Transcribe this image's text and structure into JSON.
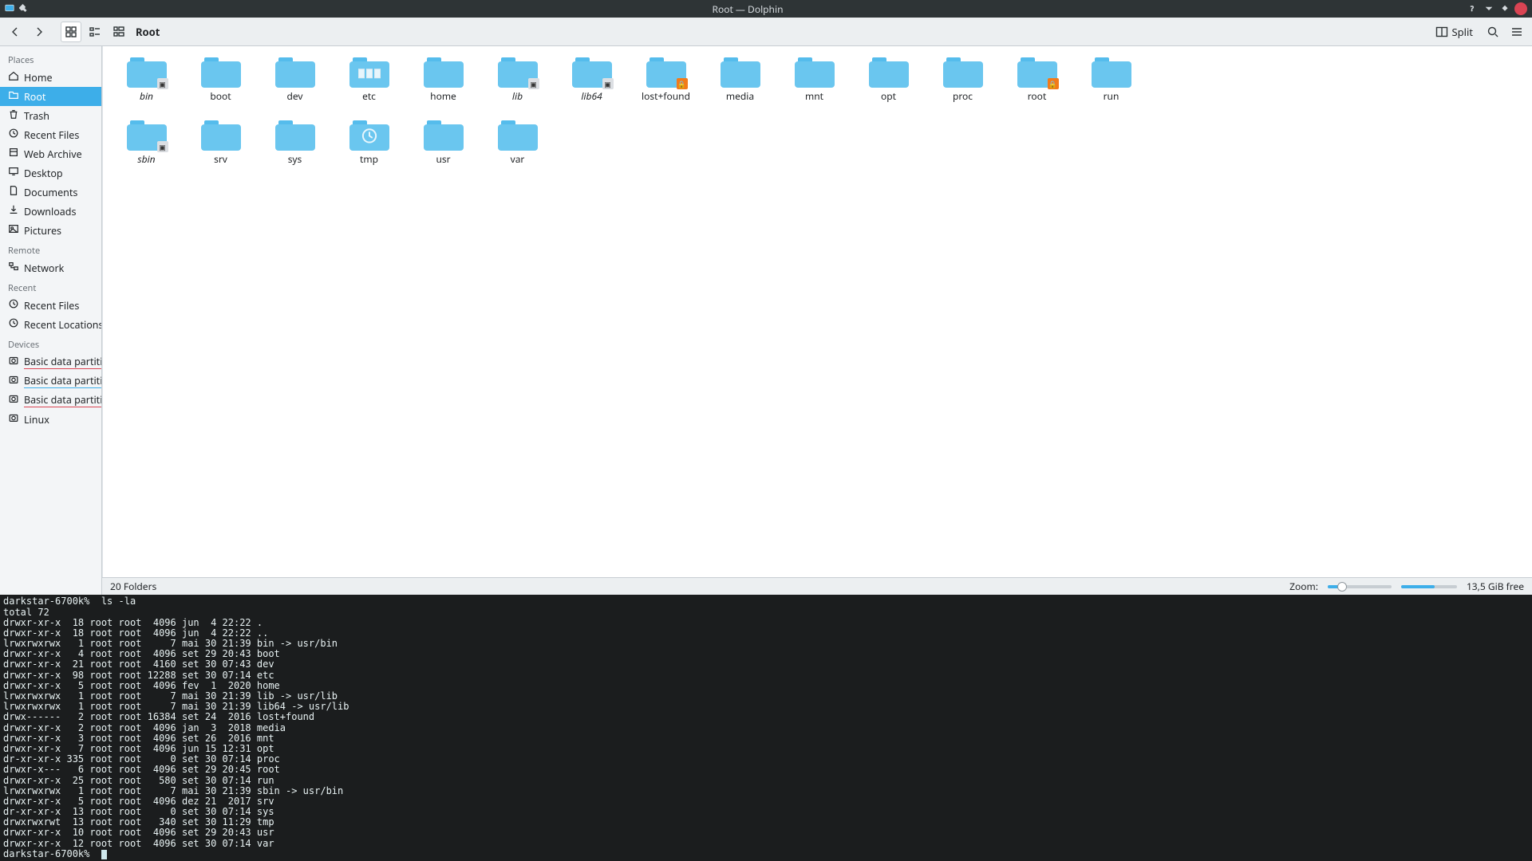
{
  "window": {
    "title": "Root — Dolphin"
  },
  "toolbar": {
    "breadcrumb": "Root",
    "split_label": "Split"
  },
  "sidebar": {
    "sections": [
      {
        "title": "Places",
        "items": [
          {
            "id": "home",
            "label": "Home"
          },
          {
            "id": "root",
            "label": "Root",
            "selected": true
          },
          {
            "id": "trash",
            "label": "Trash"
          },
          {
            "id": "recent-f",
            "label": "Recent Files"
          },
          {
            "id": "webarch",
            "label": "Web Archive"
          },
          {
            "id": "desktop",
            "label": "Desktop"
          },
          {
            "id": "docs",
            "label": "Documents"
          },
          {
            "id": "dl",
            "label": "Downloads"
          },
          {
            "id": "pics",
            "label": "Pictures"
          }
        ]
      },
      {
        "title": "Remote",
        "items": [
          {
            "id": "network",
            "label": "Network"
          }
        ]
      },
      {
        "title": "Recent",
        "items": [
          {
            "id": "r-files",
            "label": "Recent Files"
          },
          {
            "id": "r-loc",
            "label": "Recent Locations"
          }
        ]
      },
      {
        "title": "Devices",
        "items": [
          {
            "id": "bdp1",
            "label": "Basic data partition",
            "underline": "red"
          },
          {
            "id": "bdp2",
            "label": "Basic data partition",
            "underline": "blue"
          },
          {
            "id": "bdp3",
            "label": "Basic data partition",
            "underline": "red"
          },
          {
            "id": "linux",
            "label": "Linux"
          }
        ]
      }
    ]
  },
  "files": [
    {
      "name": "bin",
      "italic": true,
      "badge": "link"
    },
    {
      "name": "boot"
    },
    {
      "name": "dev"
    },
    {
      "name": "etc",
      "overlay": "docs"
    },
    {
      "name": "home"
    },
    {
      "name": "lib",
      "italic": true,
      "badge": "link"
    },
    {
      "name": "lib64",
      "italic": true,
      "badge": "link"
    },
    {
      "name": "lost+found",
      "badge": "lock"
    },
    {
      "name": "media"
    },
    {
      "name": "mnt"
    },
    {
      "name": "opt"
    },
    {
      "name": "proc"
    },
    {
      "name": "root",
      "badge": "lock"
    },
    {
      "name": "run"
    },
    {
      "name": "sbin",
      "italic": true,
      "badge": "link"
    },
    {
      "name": "srv"
    },
    {
      "name": "sys"
    },
    {
      "name": "tmp",
      "overlay": "clock"
    },
    {
      "name": "usr"
    },
    {
      "name": "var"
    }
  ],
  "statusbar": {
    "count": "20 Folders",
    "zoom_label": "Zoom:",
    "free_space": "13,5 GiB free"
  },
  "terminal": {
    "prompt": "darkstar-6700k% ",
    "command": "ls -la",
    "lines": [
      "total 72",
      "drwxr-xr-x  18 root root  4096 jun  4 22:22 .",
      "drwxr-xr-x  18 root root  4096 jun  4 22:22 ..",
      "lrwxrwxrwx   1 root root     7 mai 30 21:39 bin -> usr/bin",
      "drwxr-xr-x   4 root root  4096 set 29 20:43 boot",
      "drwxr-xr-x  21 root root  4160 set 30 07:43 dev",
      "drwxr-xr-x  98 root root 12288 set 30 07:14 etc",
      "drwxr-xr-x   5 root root  4096 fev  1  2020 home",
      "lrwxrwxrwx   1 root root     7 mai 30 21:39 lib -> usr/lib",
      "lrwxrwxrwx   1 root root     7 mai 30 21:39 lib64 -> usr/lib",
      "drwx------   2 root root 16384 set 24  2016 lost+found",
      "drwxr-xr-x   2 root root  4096 jan  3  2018 media",
      "drwxr-xr-x   3 root root  4096 set 26  2016 mnt",
      "drwxr-xr-x   7 root root  4096 jun 15 12:31 opt",
      "dr-xr-xr-x 335 root root     0 set 30 07:14 proc",
      "drwxr-x---   6 root root  4096 set 29 20:45 root",
      "drwxr-xr-x  25 root root   580 set 30 07:14 run",
      "lrwxrwxrwx   1 root root     7 mai 30 21:39 sbin -> usr/bin",
      "drwxr-xr-x   5 root root  4096 dez 21  2017 srv",
      "dr-xr-xr-x  13 root root     0 set 30 07:14 sys",
      "drwxrwxrwt  13 root root   340 set 30 11:29 tmp",
      "drwxr-xr-x  10 root root  4096 set 29 20:43 usr",
      "drwxr-xr-x  12 root root  4096 set 30 07:14 var"
    ]
  }
}
